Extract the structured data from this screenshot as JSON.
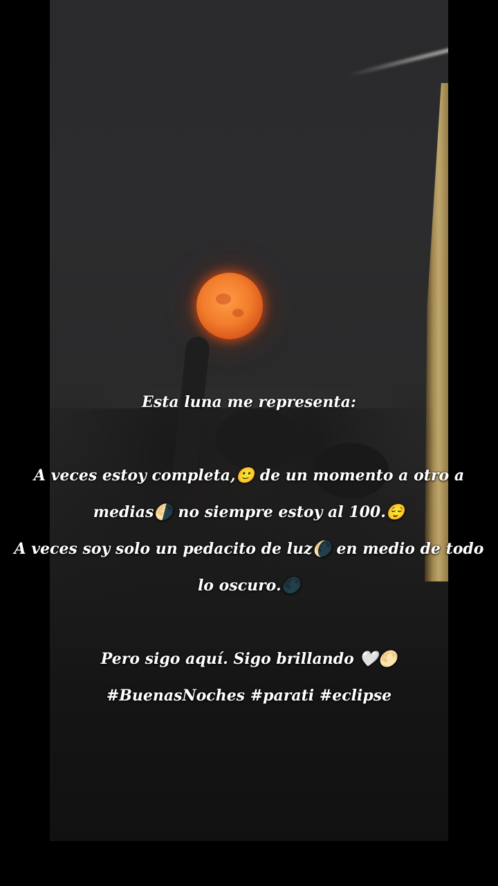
{
  "photo": {
    "moon_color": "#f27d2c",
    "sky_color": "#2c2c2e"
  },
  "caption": {
    "line1": "Esta luna me representa:",
    "line2": "A veces estoy completa,🙂 de un momento a otro a",
    "line3": "medias🌗  no siempre estoy al 100.😌",
    "line4": "A veces soy solo un pedacito de luz🌘 en medio de todo",
    "line5": "lo oscuro.🌑",
    "line6": "Pero sigo aquí. Sigo brillando 🤍🌕",
    "line7": "#BuenasNoches #parati #eclipse"
  }
}
